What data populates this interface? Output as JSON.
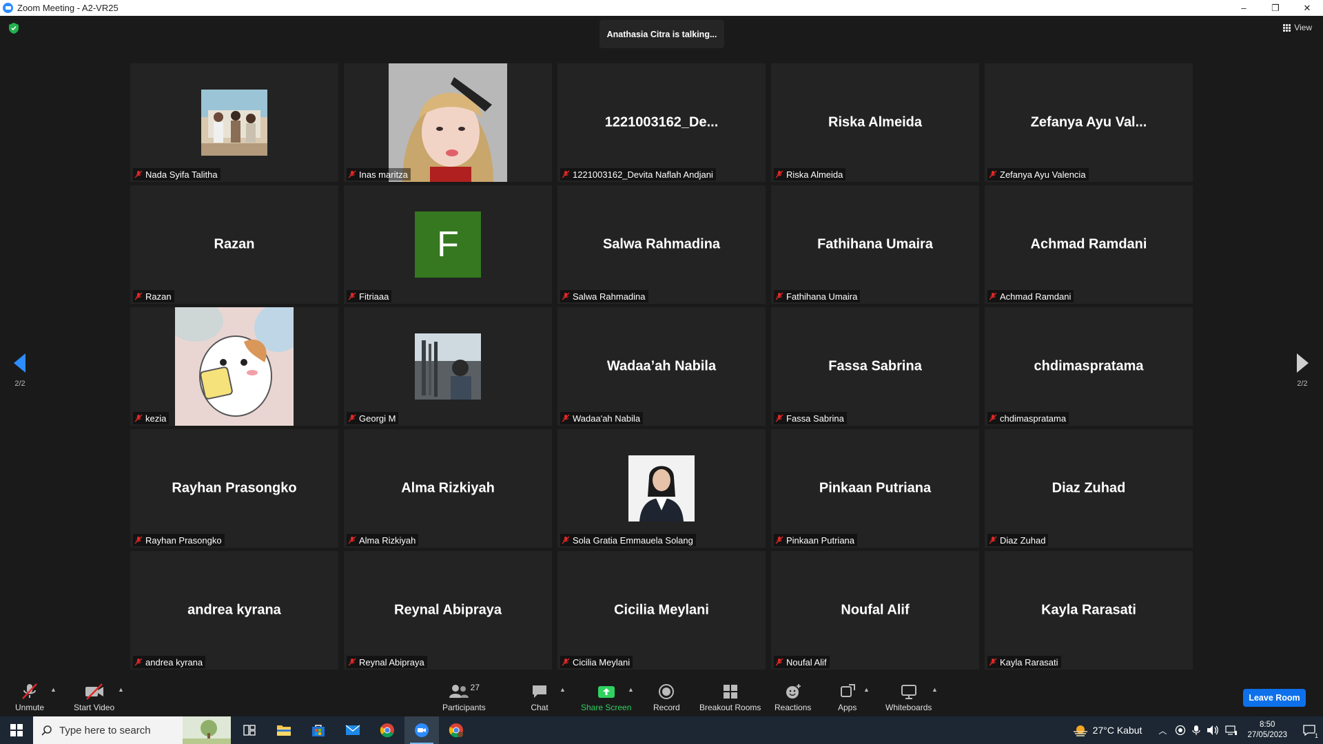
{
  "window": {
    "title": "Zoom Meeting - A2-VR25",
    "minimize": "–",
    "restore": "❐",
    "close": "✕"
  },
  "talking_banner": "Anathasia Citra is talking...",
  "view_button": "View",
  "pager": {
    "left": "2/2",
    "right": "2/2"
  },
  "tiles": [
    {
      "label": "Nada Syifa Talitha",
      "big": "",
      "avatar": "photo-group"
    },
    {
      "label": "Inas maritza",
      "big": "",
      "avatar": "photo-portrait"
    },
    {
      "label": "1221003162_Devita Naflah Andjani",
      "big": "1221003162_De...",
      "avatar": ""
    },
    {
      "label": "Riska Almeida",
      "big": "Riska Almeida",
      "avatar": ""
    },
    {
      "label": "Zefanya Ayu Valencia",
      "big": "Zefanya Ayu Val...",
      "avatar": ""
    },
    {
      "label": "Razan",
      "big": "Razan",
      "avatar": ""
    },
    {
      "label": "Fitriaaa",
      "big": "",
      "avatar": "letter",
      "letter": "F"
    },
    {
      "label": "Salwa Rahmadina",
      "big": "Salwa Rahmadina",
      "avatar": ""
    },
    {
      "label": "Fathihana Umaira",
      "big": "Fathihana Umaira",
      "avatar": ""
    },
    {
      "label": "Achmad Ramdani",
      "big": "Achmad Ramdani",
      "avatar": ""
    },
    {
      "label": "kezia",
      "big": "",
      "avatar": "photo-hamster"
    },
    {
      "label": "Georgi M",
      "big": "",
      "avatar": "photo-street"
    },
    {
      "label": "Wadaa'ah Nabila",
      "big": "Wadaa’ah Nabila",
      "avatar": ""
    },
    {
      "label": "Fassa Sabrina",
      "big": "Fassa Sabrina",
      "avatar": ""
    },
    {
      "label": "chdimaspratama",
      "big": "chdimaspratama",
      "avatar": ""
    },
    {
      "label": "Rayhan Prasongko",
      "big": "Rayhan Prasongko",
      "avatar": ""
    },
    {
      "label": "Alma Rizkiyah",
      "big": "Alma Rizkiyah",
      "avatar": ""
    },
    {
      "label": "Sola Gratia Emmauela Solang",
      "big": "",
      "avatar": "photo-formal"
    },
    {
      "label": "Pinkaan Putriana",
      "big": "Pinkaan Putriana",
      "avatar": ""
    },
    {
      "label": "Diaz Zuhad",
      "big": "Diaz Zuhad",
      "avatar": ""
    },
    {
      "label": "andrea kyrana",
      "big": "andrea kyrana",
      "avatar": ""
    },
    {
      "label": "Reynal Abipraya",
      "big": "Reynal Abipraya",
      "avatar": ""
    },
    {
      "label": "Cicilia Meylani",
      "big": "Cicilia Meylani",
      "avatar": ""
    },
    {
      "label": "Noufal Alif",
      "big": "Noufal Alif",
      "avatar": ""
    },
    {
      "label": "Kayla Rarasati",
      "big": "Kayla Rarasati",
      "avatar": ""
    }
  ],
  "toolbar": {
    "unmute": "Unmute",
    "start_video": "Start Video",
    "participants": "Participants",
    "participants_count": "27",
    "chat": "Chat",
    "share_screen": "Share Screen",
    "record": "Record",
    "breakout_rooms": "Breakout Rooms",
    "reactions": "Reactions",
    "apps": "Apps",
    "whiteboards": "Whiteboards",
    "leave": "Leave Room",
    "accent_green": "#2fd160",
    "leave_color": "#0e71eb"
  },
  "taskbar": {
    "search_placeholder": "Type here to search",
    "weather": "27°C  Kabut",
    "time": "8:50",
    "date": "27/05/2023",
    "notification_count": "1"
  }
}
